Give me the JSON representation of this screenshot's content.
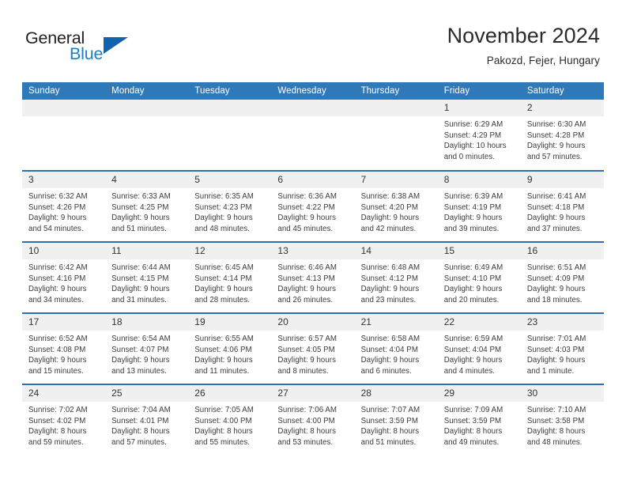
{
  "brand": {
    "name_part1": "General",
    "name_part2": "Blue",
    "triangle_color": "#1263ab",
    "blue_color": "#1c7fc4"
  },
  "header": {
    "month_title": "November 2024",
    "location": "Pakozd, Fejer, Hungary",
    "header_bg": "#3079b8",
    "row_divider": "#2f6fad",
    "daynum_bg": "#f0f0f0"
  },
  "weekday_headers": [
    "Sunday",
    "Monday",
    "Tuesday",
    "Wednesday",
    "Thursday",
    "Friday",
    "Saturday"
  ],
  "labels": {
    "sunrise": "Sunrise:",
    "sunset": "Sunset:",
    "daylight": "Daylight:"
  },
  "weeks": [
    [
      {
        "day": "",
        "empty": true
      },
      {
        "day": "",
        "empty": true
      },
      {
        "day": "",
        "empty": true
      },
      {
        "day": "",
        "empty": true
      },
      {
        "day": "",
        "empty": true
      },
      {
        "day": "1",
        "sunrise": "Sunrise: 6:29 AM",
        "sunset": "Sunset: 4:29 PM",
        "daylight1": "Daylight: 10 hours",
        "daylight2": "and 0 minutes."
      },
      {
        "day": "2",
        "sunrise": "Sunrise: 6:30 AM",
        "sunset": "Sunset: 4:28 PM",
        "daylight1": "Daylight: 9 hours",
        "daylight2": "and 57 minutes."
      }
    ],
    [
      {
        "day": "3",
        "sunrise": "Sunrise: 6:32 AM",
        "sunset": "Sunset: 4:26 PM",
        "daylight1": "Daylight: 9 hours",
        "daylight2": "and 54 minutes."
      },
      {
        "day": "4",
        "sunrise": "Sunrise: 6:33 AM",
        "sunset": "Sunset: 4:25 PM",
        "daylight1": "Daylight: 9 hours",
        "daylight2": "and 51 minutes."
      },
      {
        "day": "5",
        "sunrise": "Sunrise: 6:35 AM",
        "sunset": "Sunset: 4:23 PM",
        "daylight1": "Daylight: 9 hours",
        "daylight2": "and 48 minutes."
      },
      {
        "day": "6",
        "sunrise": "Sunrise: 6:36 AM",
        "sunset": "Sunset: 4:22 PM",
        "daylight1": "Daylight: 9 hours",
        "daylight2": "and 45 minutes."
      },
      {
        "day": "7",
        "sunrise": "Sunrise: 6:38 AM",
        "sunset": "Sunset: 4:20 PM",
        "daylight1": "Daylight: 9 hours",
        "daylight2": "and 42 minutes."
      },
      {
        "day": "8",
        "sunrise": "Sunrise: 6:39 AM",
        "sunset": "Sunset: 4:19 PM",
        "daylight1": "Daylight: 9 hours",
        "daylight2": "and 39 minutes."
      },
      {
        "day": "9",
        "sunrise": "Sunrise: 6:41 AM",
        "sunset": "Sunset: 4:18 PM",
        "daylight1": "Daylight: 9 hours",
        "daylight2": "and 37 minutes."
      }
    ],
    [
      {
        "day": "10",
        "sunrise": "Sunrise: 6:42 AM",
        "sunset": "Sunset: 4:16 PM",
        "daylight1": "Daylight: 9 hours",
        "daylight2": "and 34 minutes."
      },
      {
        "day": "11",
        "sunrise": "Sunrise: 6:44 AM",
        "sunset": "Sunset: 4:15 PM",
        "daylight1": "Daylight: 9 hours",
        "daylight2": "and 31 minutes."
      },
      {
        "day": "12",
        "sunrise": "Sunrise: 6:45 AM",
        "sunset": "Sunset: 4:14 PM",
        "daylight1": "Daylight: 9 hours",
        "daylight2": "and 28 minutes."
      },
      {
        "day": "13",
        "sunrise": "Sunrise: 6:46 AM",
        "sunset": "Sunset: 4:13 PM",
        "daylight1": "Daylight: 9 hours",
        "daylight2": "and 26 minutes."
      },
      {
        "day": "14",
        "sunrise": "Sunrise: 6:48 AM",
        "sunset": "Sunset: 4:12 PM",
        "daylight1": "Daylight: 9 hours",
        "daylight2": "and 23 minutes."
      },
      {
        "day": "15",
        "sunrise": "Sunrise: 6:49 AM",
        "sunset": "Sunset: 4:10 PM",
        "daylight1": "Daylight: 9 hours",
        "daylight2": "and 20 minutes."
      },
      {
        "day": "16",
        "sunrise": "Sunrise: 6:51 AM",
        "sunset": "Sunset: 4:09 PM",
        "daylight1": "Daylight: 9 hours",
        "daylight2": "and 18 minutes."
      }
    ],
    [
      {
        "day": "17",
        "sunrise": "Sunrise: 6:52 AM",
        "sunset": "Sunset: 4:08 PM",
        "daylight1": "Daylight: 9 hours",
        "daylight2": "and 15 minutes."
      },
      {
        "day": "18",
        "sunrise": "Sunrise: 6:54 AM",
        "sunset": "Sunset: 4:07 PM",
        "daylight1": "Daylight: 9 hours",
        "daylight2": "and 13 minutes."
      },
      {
        "day": "19",
        "sunrise": "Sunrise: 6:55 AM",
        "sunset": "Sunset: 4:06 PM",
        "daylight1": "Daylight: 9 hours",
        "daylight2": "and 11 minutes."
      },
      {
        "day": "20",
        "sunrise": "Sunrise: 6:57 AM",
        "sunset": "Sunset: 4:05 PM",
        "daylight1": "Daylight: 9 hours",
        "daylight2": "and 8 minutes."
      },
      {
        "day": "21",
        "sunrise": "Sunrise: 6:58 AM",
        "sunset": "Sunset: 4:04 PM",
        "daylight1": "Daylight: 9 hours",
        "daylight2": "and 6 minutes."
      },
      {
        "day": "22",
        "sunrise": "Sunrise: 6:59 AM",
        "sunset": "Sunset: 4:04 PM",
        "daylight1": "Daylight: 9 hours",
        "daylight2": "and 4 minutes."
      },
      {
        "day": "23",
        "sunrise": "Sunrise: 7:01 AM",
        "sunset": "Sunset: 4:03 PM",
        "daylight1": "Daylight: 9 hours",
        "daylight2": "and 1 minute."
      }
    ],
    [
      {
        "day": "24",
        "sunrise": "Sunrise: 7:02 AM",
        "sunset": "Sunset: 4:02 PM",
        "daylight1": "Daylight: 8 hours",
        "daylight2": "and 59 minutes."
      },
      {
        "day": "25",
        "sunrise": "Sunrise: 7:04 AM",
        "sunset": "Sunset: 4:01 PM",
        "daylight1": "Daylight: 8 hours",
        "daylight2": "and 57 minutes."
      },
      {
        "day": "26",
        "sunrise": "Sunrise: 7:05 AM",
        "sunset": "Sunset: 4:00 PM",
        "daylight1": "Daylight: 8 hours",
        "daylight2": "and 55 minutes."
      },
      {
        "day": "27",
        "sunrise": "Sunrise: 7:06 AM",
        "sunset": "Sunset: 4:00 PM",
        "daylight1": "Daylight: 8 hours",
        "daylight2": "and 53 minutes."
      },
      {
        "day": "28",
        "sunrise": "Sunrise: 7:07 AM",
        "sunset": "Sunset: 3:59 PM",
        "daylight1": "Daylight: 8 hours",
        "daylight2": "and 51 minutes."
      },
      {
        "day": "29",
        "sunrise": "Sunrise: 7:09 AM",
        "sunset": "Sunset: 3:59 PM",
        "daylight1": "Daylight: 8 hours",
        "daylight2": "and 49 minutes."
      },
      {
        "day": "30",
        "sunrise": "Sunrise: 7:10 AM",
        "sunset": "Sunset: 3:58 PM",
        "daylight1": "Daylight: 8 hours",
        "daylight2": "and 48 minutes."
      }
    ]
  ]
}
